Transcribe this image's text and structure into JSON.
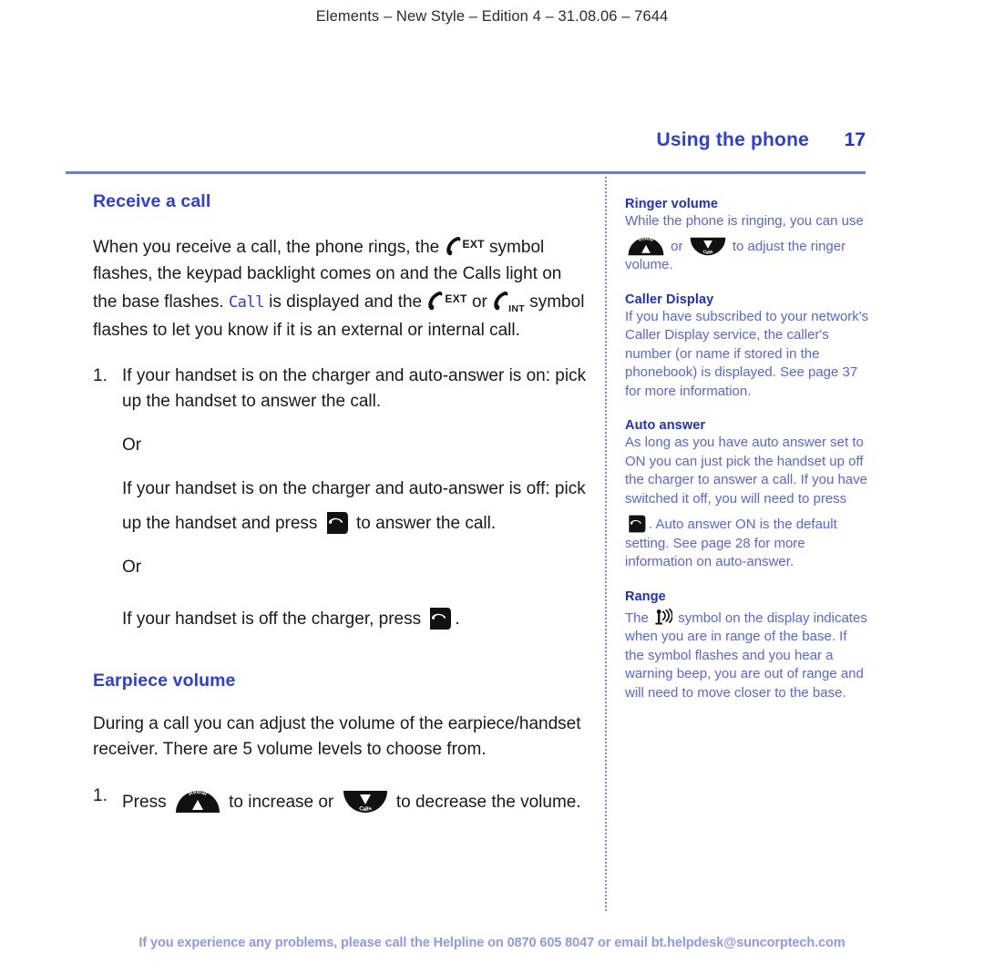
{
  "running_head": "Elements – New Style – Edition 4 – 31.08.06 – 7644",
  "header": {
    "chapter_title": "Using the phone",
    "page_number": "17"
  },
  "main": {
    "section1": {
      "heading": "Receive a call",
      "intro_part1": "When you receive a call, the phone rings, the",
      "intro_ext_label": "EXT",
      "intro_part2": "symbol flashes, the keypad backlight comes on and the Calls light on the base flashes.",
      "lcd_word": "Call",
      "intro_part3": "is displayed and the",
      "intro_ext_label2": "EXT",
      "intro_or": "or",
      "intro_int_label": "INT",
      "intro_part4": "symbol flashes to let you know if it is an external or internal call.",
      "item1_number": "1.",
      "item1_text": "If your handset is on the charger and auto-answer is on: pick up the handset to answer the call.",
      "or_1": "Or",
      "item2_text_a": "If your handset is on the charger and auto-answer is off: pick up the handset and press",
      "item2_text_b": "to answer the call.",
      "or_2": "Or",
      "item3_text_a": "If your handset is off the charger, press",
      "item3_text_b": "."
    },
    "section2": {
      "heading": "Earpiece volume",
      "paragraph": "During a call you can adjust the volume of the earpiece/handset receiver. There are 5 volume levels to choose from.",
      "item1_number": "1.",
      "item1_text_a": "Press",
      "item1_text_b": "to increase or",
      "item1_text_c": "to decrease the volume."
    }
  },
  "sidebar": {
    "blocks": [
      {
        "heading": "Ringer volume",
        "text_a": "While the phone is ringing, you can use",
        "text_b": "or",
        "text_c": "to adjust the ringer volume."
      },
      {
        "heading": "Caller Display",
        "text": "If you have subscribed to your network's Caller Display service, the caller's number (or name if stored in the phonebook) is displayed. See page 37 for more information."
      },
      {
        "heading": "Auto answer",
        "text_a": "As long as you have auto answer set to ON you can just pick the handset up off the charger to answer a call. If you have switched it off, you will need to press",
        "text_b": ". Auto answer ON is the default setting. See page 28 for more information on auto-answer."
      },
      {
        "heading": "Range",
        "text_a": "The",
        "text_b": "symbol on the display indicates when you are in range of the base. If the symbol flashes and you hear a warning beep, you are out of range and will need to move closer to the base."
      }
    ]
  },
  "icons": {
    "redial_key_label": "Redial",
    "calls_key_label": "Calls"
  },
  "footer": "If you experience any problems, please call the Helpline on 0870 605 8047 or email bt.helpdesk@suncorptech.com",
  "colors": {
    "heading_blue": "#2b3ee0",
    "sidebar_heading_blue": "#1f2fcf",
    "sidebar_body_blue": "#5566e8",
    "rule_blue": "#6b79e8",
    "footer_blue": "#8c99f0"
  }
}
